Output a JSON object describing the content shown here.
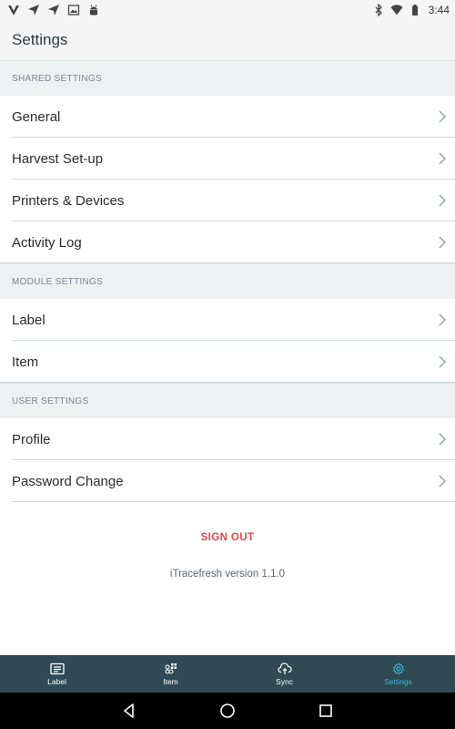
{
  "status_bar": {
    "time": "3:44",
    "left_icons": [
      "v-app-icon",
      "send-icon",
      "send-icon",
      "image-icon",
      "android-icon"
    ],
    "right_icons": [
      "bluetooth-icon",
      "wifi-icon",
      "battery-icon"
    ]
  },
  "header": {
    "title": "Settings"
  },
  "sections": [
    {
      "label": "SHARED SETTINGS",
      "items": [
        {
          "label": "General"
        },
        {
          "label": "Harvest Set-up"
        },
        {
          "label": "Printers & Devices"
        },
        {
          "label": "Activity Log"
        }
      ]
    },
    {
      "label": "MODULE SETTINGS",
      "items": [
        {
          "label": "Label"
        },
        {
          "label": "Item"
        }
      ]
    },
    {
      "label": "USER SETTINGS",
      "items": [
        {
          "label": "Profile"
        },
        {
          "label": "Password Change"
        }
      ]
    }
  ],
  "sign_out_label": "SIGN OUT",
  "version_text": "iTracefresh version 1.1.0",
  "tabs": [
    {
      "label": "Label",
      "icon": "label-icon",
      "active": false
    },
    {
      "label": "Item",
      "icon": "item-icon",
      "active": false
    },
    {
      "label": "Sync",
      "icon": "cloud-sync-icon",
      "active": false
    },
    {
      "label": "Settings",
      "icon": "gear-icon",
      "active": true
    }
  ],
  "colors": {
    "accent": "#34b6d6",
    "tab_bar": "#2f4a55",
    "sign_out": "#e24545",
    "section_bg": "#eef1f2"
  }
}
